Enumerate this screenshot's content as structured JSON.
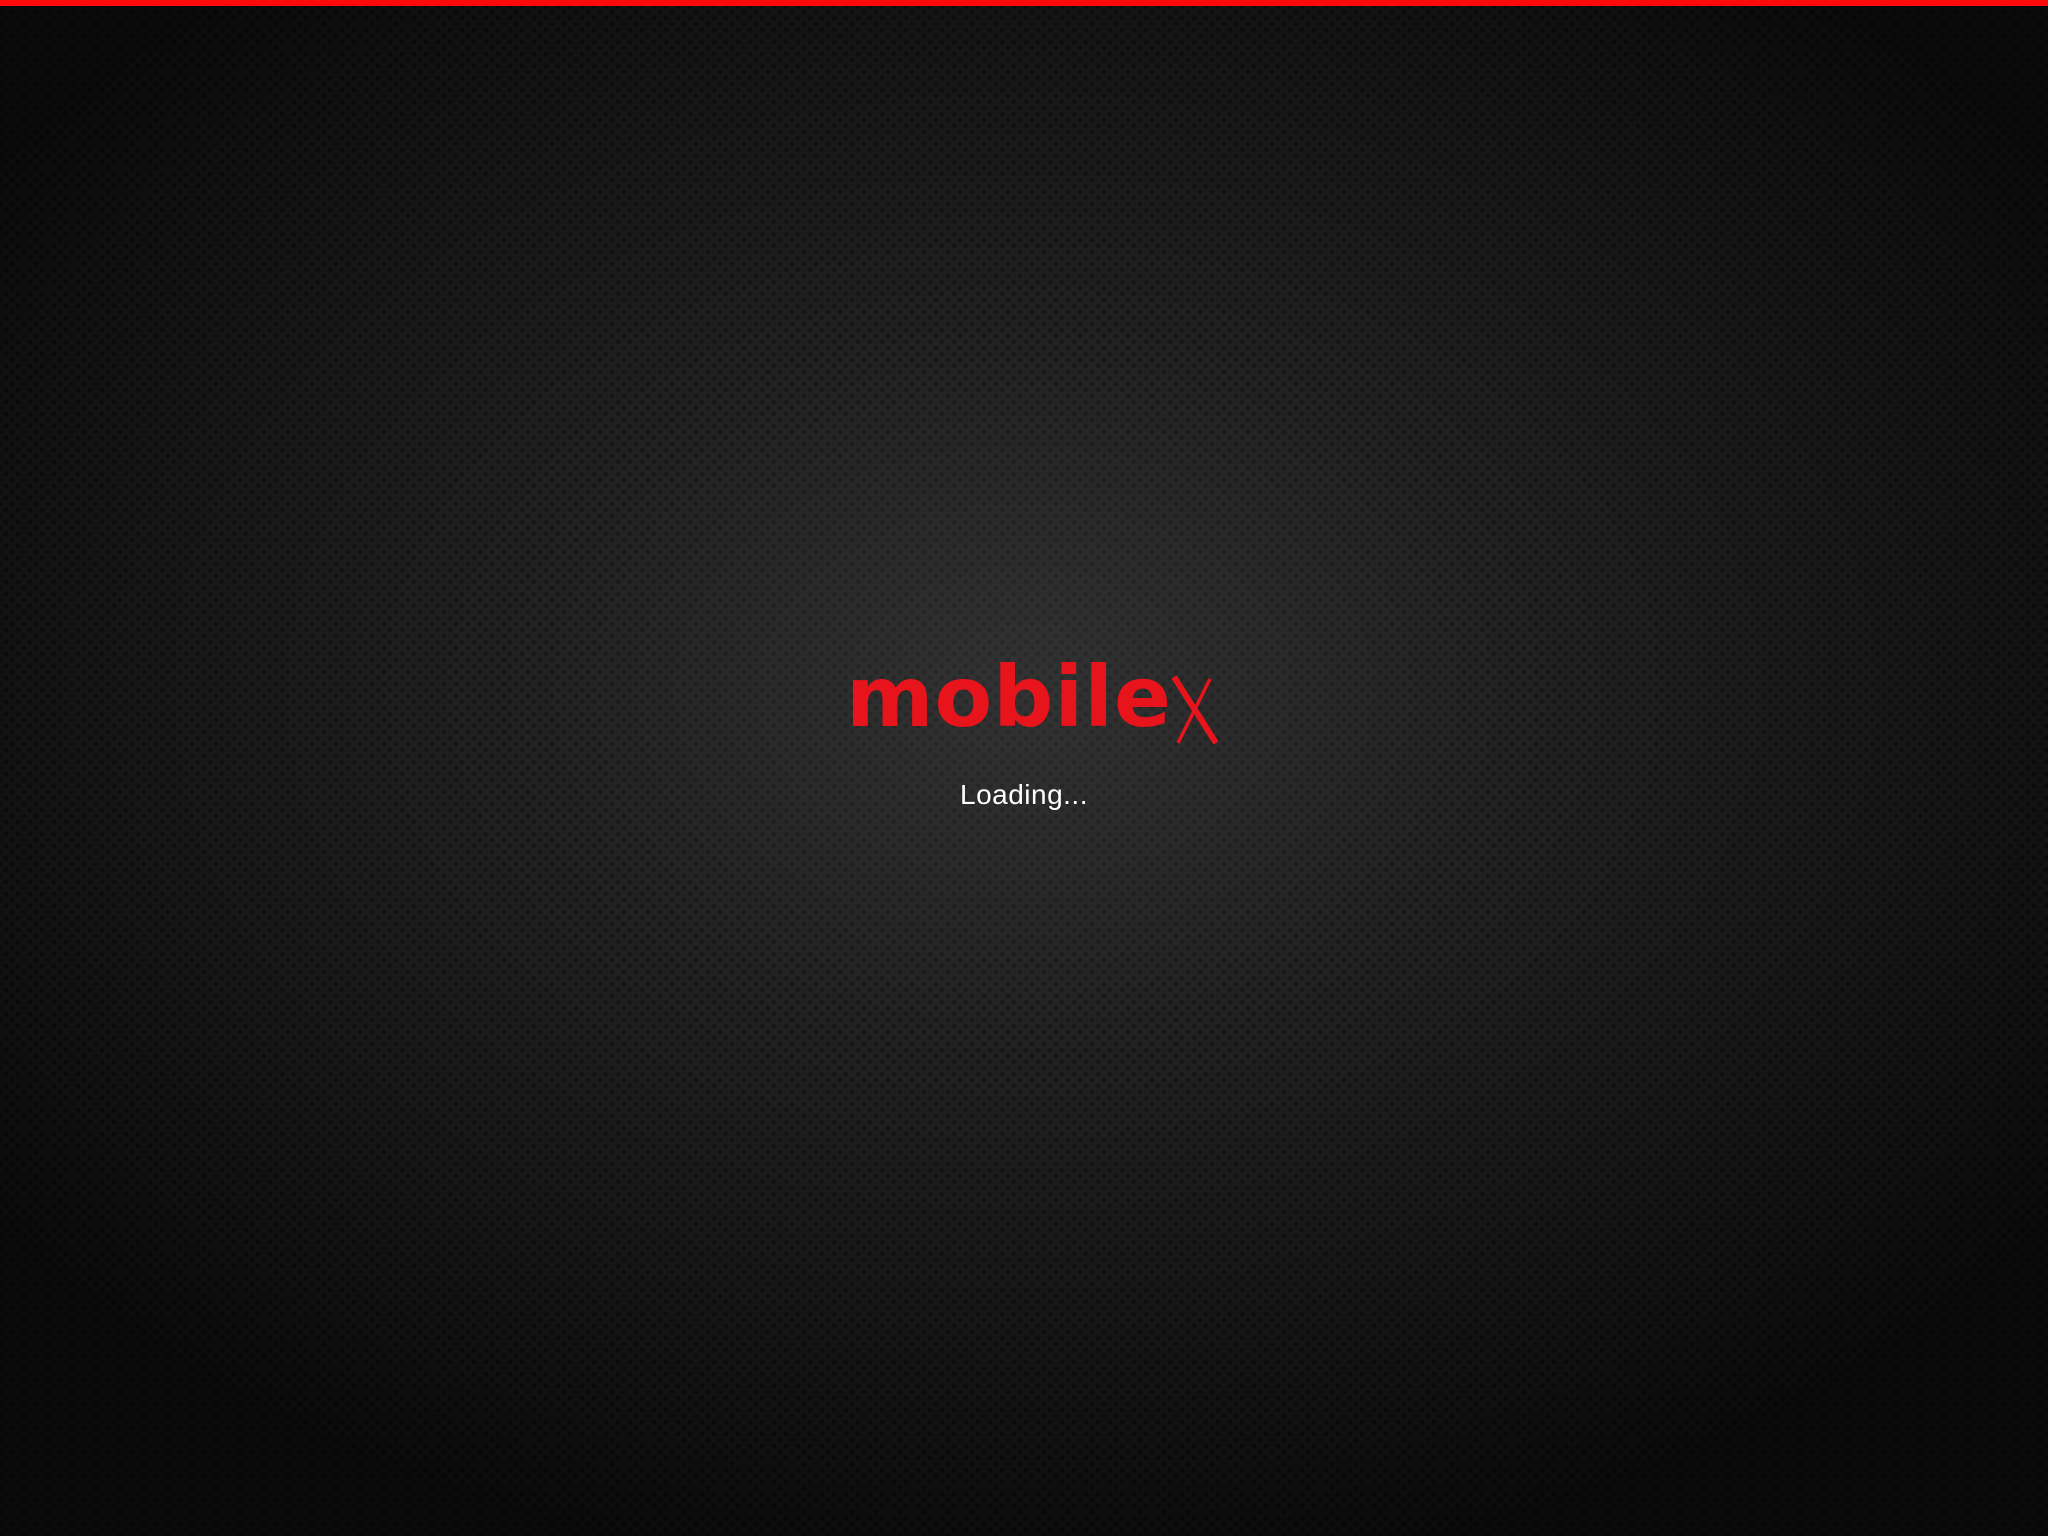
{
  "app": {
    "logo_text": "mobilex",
    "loading_text": "Loading..."
  },
  "theme": {
    "accent": "#e8141b",
    "top_bar": "#ff0a0a",
    "background": "#1b1b1b",
    "text": "#ffffff"
  }
}
